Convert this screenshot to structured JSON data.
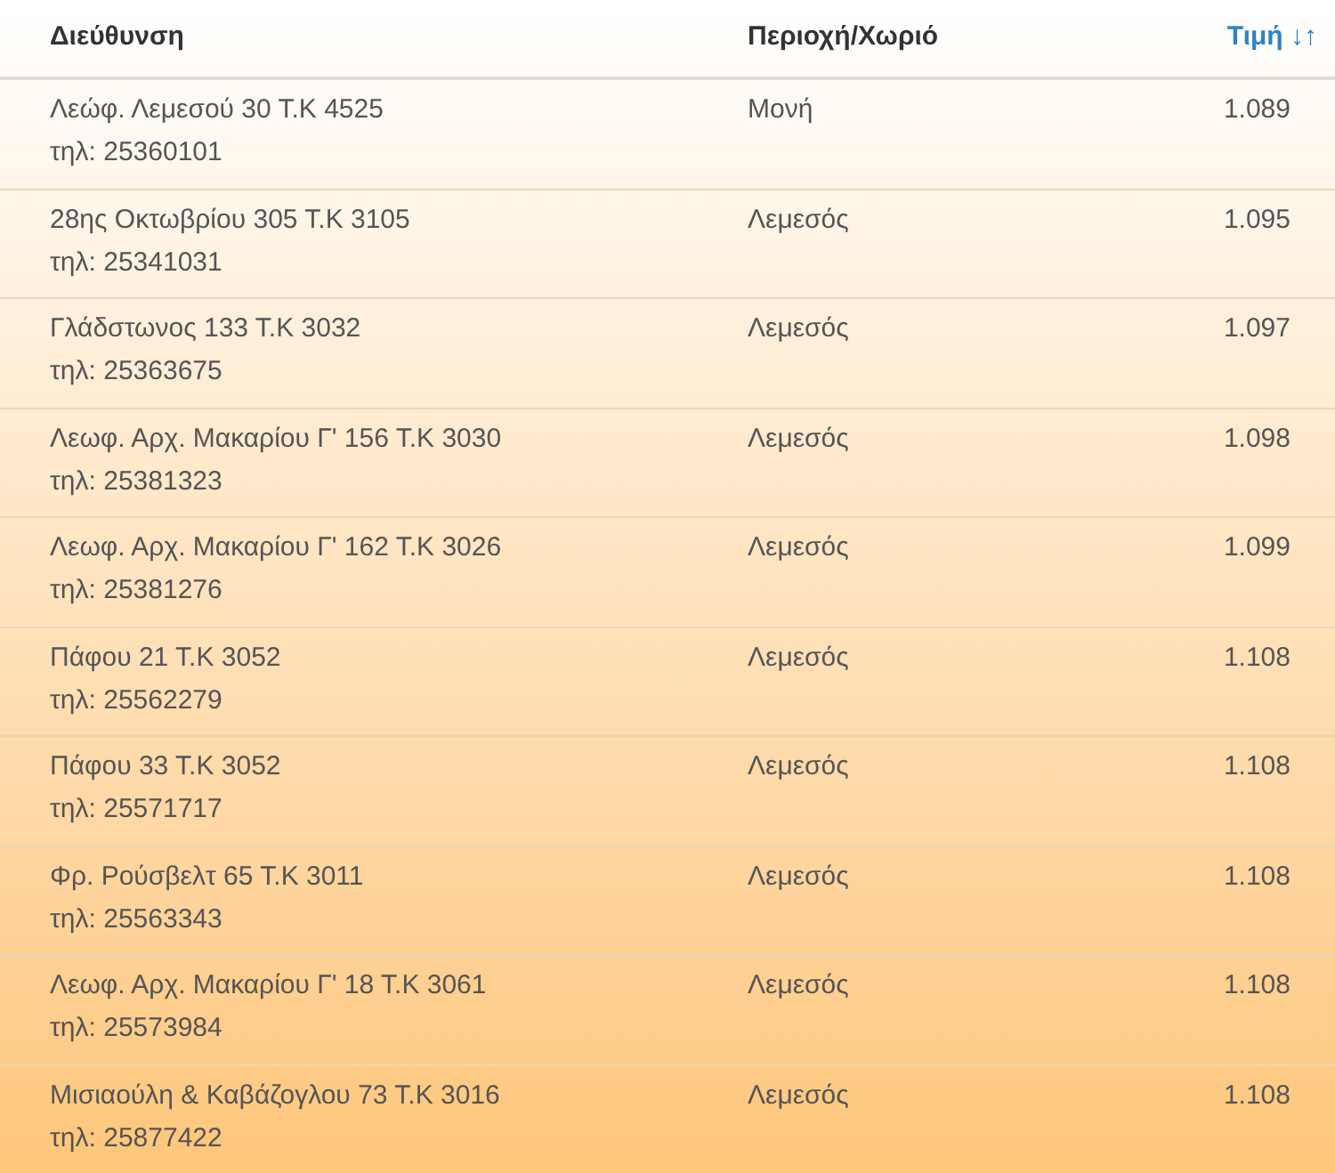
{
  "table": {
    "columns": [
      {
        "label": "Διεύθυνση",
        "sortable": false
      },
      {
        "label": "Περιοχή/Χωριό",
        "sortable": false
      },
      {
        "label": "Τιμή",
        "sortable": true,
        "sort_icon": "↓↑"
      }
    ],
    "rows": [
      {
        "address": "Λεώφ. Λεμεσού 30 Τ.Κ 4525",
        "phone": "τηλ: 25360101",
        "area": "Μονή",
        "price": "1.089"
      },
      {
        "address": "28ης Οκτωβρίου 305 Τ.Κ 3105",
        "phone": "τηλ: 25341031",
        "area": "Λεμεσός",
        "price": "1.095"
      },
      {
        "address": "Γλάδστωνος 133 Τ.Κ 3032",
        "phone": "τηλ: 25363675",
        "area": "Λεμεσός",
        "price": "1.097"
      },
      {
        "address": "Λεωφ. Αρχ. Μακαρίου Γ' 156 Τ.Κ 3030",
        "phone": "τηλ: 25381323",
        "area": "Λεμεσός",
        "price": "1.098"
      },
      {
        "address": "Λεωφ. Αρχ. Μακαρίου Γ' 162 Τ.Κ 3026",
        "phone": "τηλ: 25381276",
        "area": "Λεμεσός",
        "price": "1.099"
      },
      {
        "address": "Πάφου 21 Τ.Κ 3052",
        "phone": "τηλ: 25562279",
        "area": "Λεμεσός",
        "price": "1.108"
      },
      {
        "address": "Πάφου 33 Τ.Κ 3052",
        "phone": "τηλ: 25571717",
        "area": "Λεμεσός",
        "price": "1.108"
      },
      {
        "address": "Φρ. Ρούσβελτ 65 Τ.Κ 3011",
        "phone": "τηλ: 25563343",
        "area": "Λεμεσός",
        "price": "1.108"
      },
      {
        "address": "Λεωφ. Αρχ. Μακαρίου Γ' 18 Τ.Κ 3061",
        "phone": "τηλ: 25573984",
        "area": "Λεμεσός",
        "price": "1.108"
      },
      {
        "address": "Μισιαούλη & Καβάζογλου 73 Τ.Κ 3016",
        "phone": "τηλ: 25877422",
        "area": "Λεμεσός",
        "price": "1.108"
      }
    ]
  }
}
